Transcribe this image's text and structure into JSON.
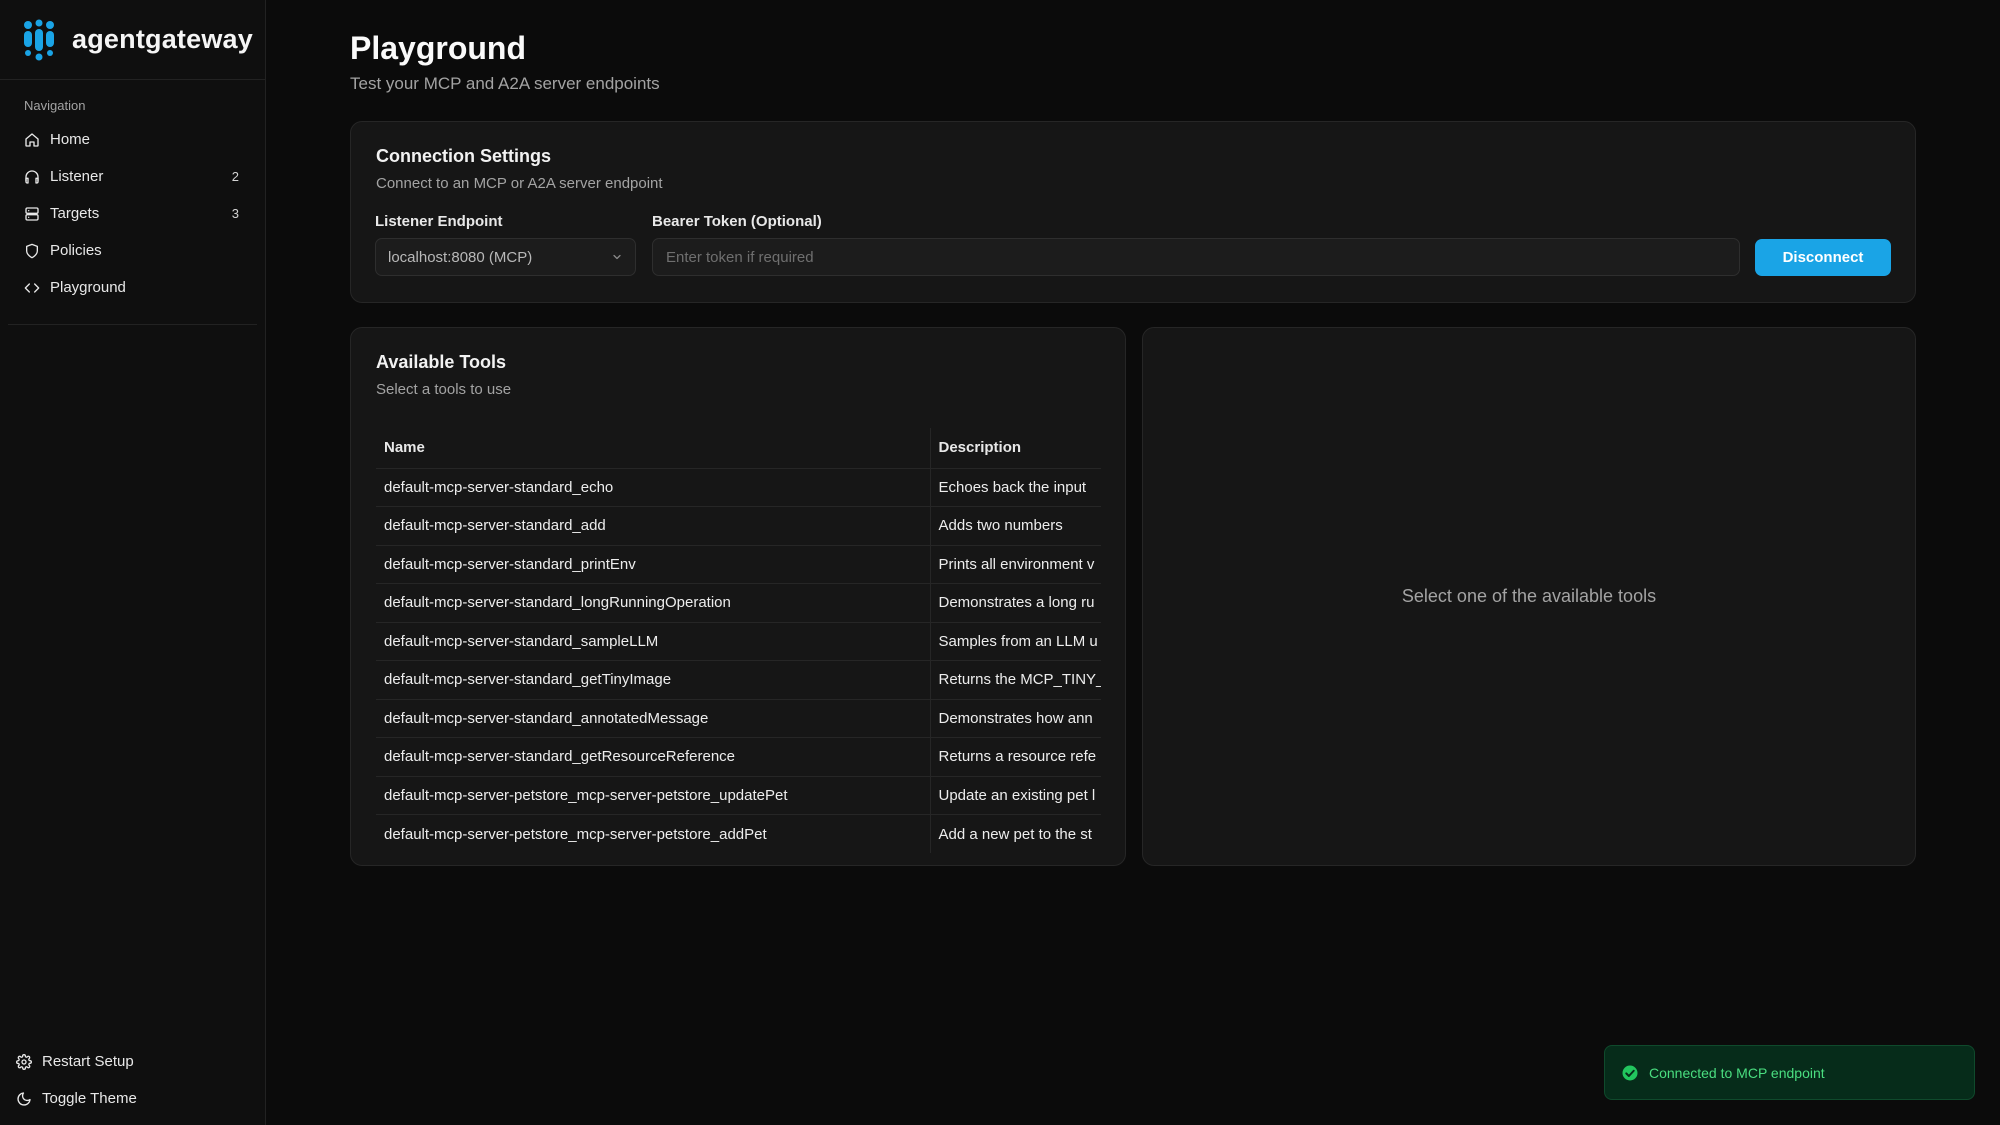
{
  "brand": {
    "name": "agentgateway",
    "accent": "#1aa4e6"
  },
  "sidebar": {
    "heading": "Navigation",
    "items": [
      {
        "label": "Home",
        "icon": "home-icon",
        "count": ""
      },
      {
        "label": "Listener",
        "icon": "headphones-icon",
        "count": "2"
      },
      {
        "label": "Targets",
        "icon": "server-icon",
        "count": "3"
      },
      {
        "label": "Policies",
        "icon": "shield-icon",
        "count": ""
      },
      {
        "label": "Playground",
        "icon": "code-icon",
        "count": ""
      }
    ],
    "bottom": [
      {
        "label": "Restart Setup",
        "icon": "gear-icon"
      },
      {
        "label": "Toggle Theme",
        "icon": "moon-icon"
      }
    ]
  },
  "page": {
    "title": "Playground",
    "subtitle": "Test your MCP and A2A server endpoints"
  },
  "connection": {
    "title": "Connection Settings",
    "subtitle": "Connect to an MCP or A2A server endpoint",
    "endpoint_label": "Listener Endpoint",
    "endpoint_value": "localhost:8080 (MCP)",
    "token_label": "Bearer Token (Optional)",
    "token_placeholder": "Enter token if required",
    "token_value": "",
    "disconnect_label": "Disconnect"
  },
  "tools": {
    "title": "Available Tools",
    "subtitle": "Select a tools to use",
    "columns": [
      "Name",
      "Description"
    ],
    "rows": [
      {
        "name": "default-mcp-server-standard_echo",
        "description": "Echoes back the input"
      },
      {
        "name": "default-mcp-server-standard_add",
        "description": "Adds two numbers"
      },
      {
        "name": "default-mcp-server-standard_printEnv",
        "description": "Prints all environment v"
      },
      {
        "name": "default-mcp-server-standard_longRunningOperation",
        "description": "Demonstrates a long ru"
      },
      {
        "name": "default-mcp-server-standard_sampleLLM",
        "description": "Samples from an LLM u"
      },
      {
        "name": "default-mcp-server-standard_getTinyImage",
        "description": "Returns the MCP_TINY_"
      },
      {
        "name": "default-mcp-server-standard_annotatedMessage",
        "description": "Demonstrates how ann"
      },
      {
        "name": "default-mcp-server-standard_getResourceReference",
        "description": "Returns a resource refe"
      },
      {
        "name": "default-mcp-server-petstore_mcp-server-petstore_updatePet",
        "description": "Update an existing pet l"
      },
      {
        "name": "default-mcp-server-petstore_mcp-server-petstore_addPet",
        "description": "Add a new pet to the st"
      }
    ]
  },
  "detail": {
    "empty_text": "Select one of the available tools"
  },
  "toast": {
    "message": "Connected to MCP endpoint",
    "icon": "check-circle-icon",
    "color": "#4ade80"
  }
}
